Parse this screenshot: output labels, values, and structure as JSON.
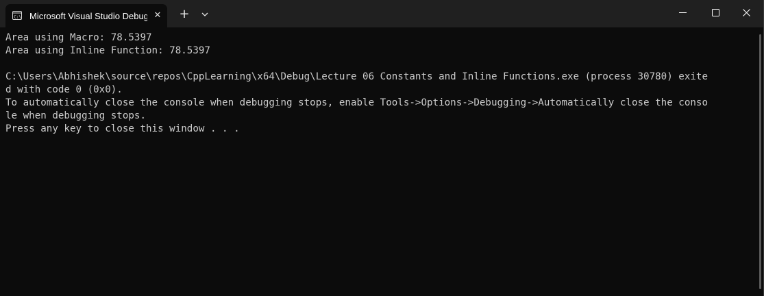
{
  "window": {
    "tab_title": "Microsoft Visual Studio Debug Console",
    "tab_icon": "terminal-icon",
    "close_tab_glyph": "✕",
    "new_tab_glyph": "+",
    "dropdown_icon": "chevron-down-icon",
    "controls": [
      "minimize-icon",
      "maximize-icon",
      "close-icon"
    ]
  },
  "console": {
    "lines": [
      "Area using Macro: 78.5397",
      "Area using Inline Function: 78.5397",
      "",
      "C:\\Users\\Abhishek\\source\\repos\\CppLearning\\x64\\Debug\\Lecture 06 Constants and Inline Functions.exe (process 30780) exite",
      "d with code 0 (0x0).",
      "To automatically close the console when debugging stops, enable Tools->Options->Debugging->Automatically close the conso",
      "le when debugging stops.",
      "Press any key to close this window . . ."
    ]
  },
  "colors": {
    "background": "#0c0c0c",
    "titlebar": "#202020",
    "text": "#cccccc"
  }
}
